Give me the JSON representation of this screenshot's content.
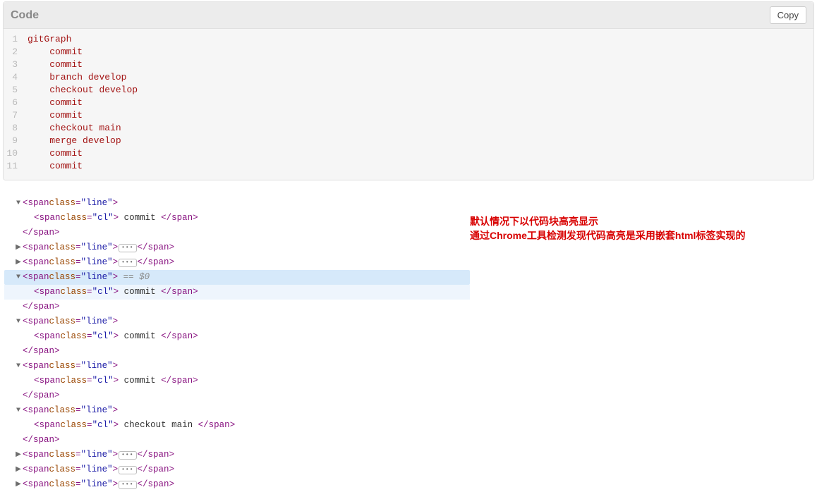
{
  "code_panel": {
    "title": "Code",
    "copy_label": "Copy",
    "lines": [
      {
        "n": "1",
        "indent": 0,
        "tokens": [
          {
            "t": "kw",
            "v": "gitGraph"
          }
        ]
      },
      {
        "n": "2",
        "indent": 1,
        "tokens": [
          {
            "t": "kw",
            "v": "commit"
          }
        ]
      },
      {
        "n": "3",
        "indent": 1,
        "tokens": [
          {
            "t": "kw",
            "v": "commit"
          }
        ]
      },
      {
        "n": "4",
        "indent": 1,
        "tokens": [
          {
            "t": "kw",
            "v": "branch"
          },
          {
            "t": "sp",
            "v": " "
          },
          {
            "t": "ident",
            "v": "develop"
          }
        ]
      },
      {
        "n": "5",
        "indent": 1,
        "tokens": [
          {
            "t": "kw",
            "v": "checkout"
          },
          {
            "t": "sp",
            "v": " "
          },
          {
            "t": "ident",
            "v": "develop"
          }
        ]
      },
      {
        "n": "6",
        "indent": 1,
        "tokens": [
          {
            "t": "kw",
            "v": "commit"
          }
        ]
      },
      {
        "n": "7",
        "indent": 1,
        "tokens": [
          {
            "t": "kw",
            "v": "commit"
          }
        ]
      },
      {
        "n": "8",
        "indent": 1,
        "tokens": [
          {
            "t": "kw",
            "v": "checkout"
          },
          {
            "t": "sp",
            "v": " "
          },
          {
            "t": "ident",
            "v": "main"
          }
        ]
      },
      {
        "n": "9",
        "indent": 1,
        "tokens": [
          {
            "t": "kw",
            "v": "merge"
          },
          {
            "t": "sp",
            "v": " "
          },
          {
            "t": "ident",
            "v": "develop"
          }
        ]
      },
      {
        "n": "10",
        "indent": 1,
        "tokens": [
          {
            "t": "kw",
            "v": "commit"
          }
        ]
      },
      {
        "n": "11",
        "indent": 1,
        "tokens": [
          {
            "t": "kw",
            "v": "commit"
          }
        ]
      }
    ]
  },
  "devtools": {
    "tag_span": "span",
    "attr_class": "class",
    "val_line": "line",
    "val_cl": "cl",
    "eq0": " == $0",
    "dots": "•••",
    "nodes": [
      {
        "kind": "open-expanded",
        "arrow": "▼",
        "cls": "line",
        "indent": 1
      },
      {
        "kind": "child-full",
        "cls": "cl",
        "indent": 2,
        "text": " commit "
      },
      {
        "kind": "close",
        "cls": "",
        "indent": 1
      },
      {
        "kind": "collapsed",
        "arrow": "▶",
        "cls": "line",
        "indent": 1
      },
      {
        "kind": "collapsed",
        "arrow": "▶",
        "cls": "line",
        "indent": 1
      },
      {
        "kind": "open-selected",
        "arrow": "▼",
        "cls": "line",
        "indent": 1
      },
      {
        "kind": "child-full-sel",
        "cls": "cl",
        "indent": 2,
        "text": " commit "
      },
      {
        "kind": "close",
        "cls": "",
        "indent": 1
      },
      {
        "kind": "open-expanded",
        "arrow": "▼",
        "cls": "line",
        "indent": 1
      },
      {
        "kind": "child-full",
        "cls": "cl",
        "indent": 2,
        "text": " commit "
      },
      {
        "kind": "close",
        "cls": "",
        "indent": 1
      },
      {
        "kind": "open-expanded",
        "arrow": "▼",
        "cls": "line",
        "indent": 1
      },
      {
        "kind": "child-full",
        "cls": "cl",
        "indent": 2,
        "text": " commit "
      },
      {
        "kind": "close",
        "cls": "",
        "indent": 1
      },
      {
        "kind": "open-expanded",
        "arrow": "▼",
        "cls": "line",
        "indent": 1
      },
      {
        "kind": "child-full",
        "cls": "cl",
        "indent": 2,
        "text": " checkout main "
      },
      {
        "kind": "close",
        "cls": "",
        "indent": 1
      },
      {
        "kind": "collapsed",
        "arrow": "▶",
        "cls": "line",
        "indent": 1
      },
      {
        "kind": "collapsed",
        "arrow": "▶",
        "cls": "line",
        "indent": 1
      },
      {
        "kind": "collapsed",
        "arrow": "▶",
        "cls": "line",
        "indent": 1
      }
    ]
  },
  "annotation": {
    "line1": "默认情况下以代码块高亮显示",
    "line2": "通过Chrome工具检测发现代码高亮是采用嵌套html标签实现的"
  }
}
